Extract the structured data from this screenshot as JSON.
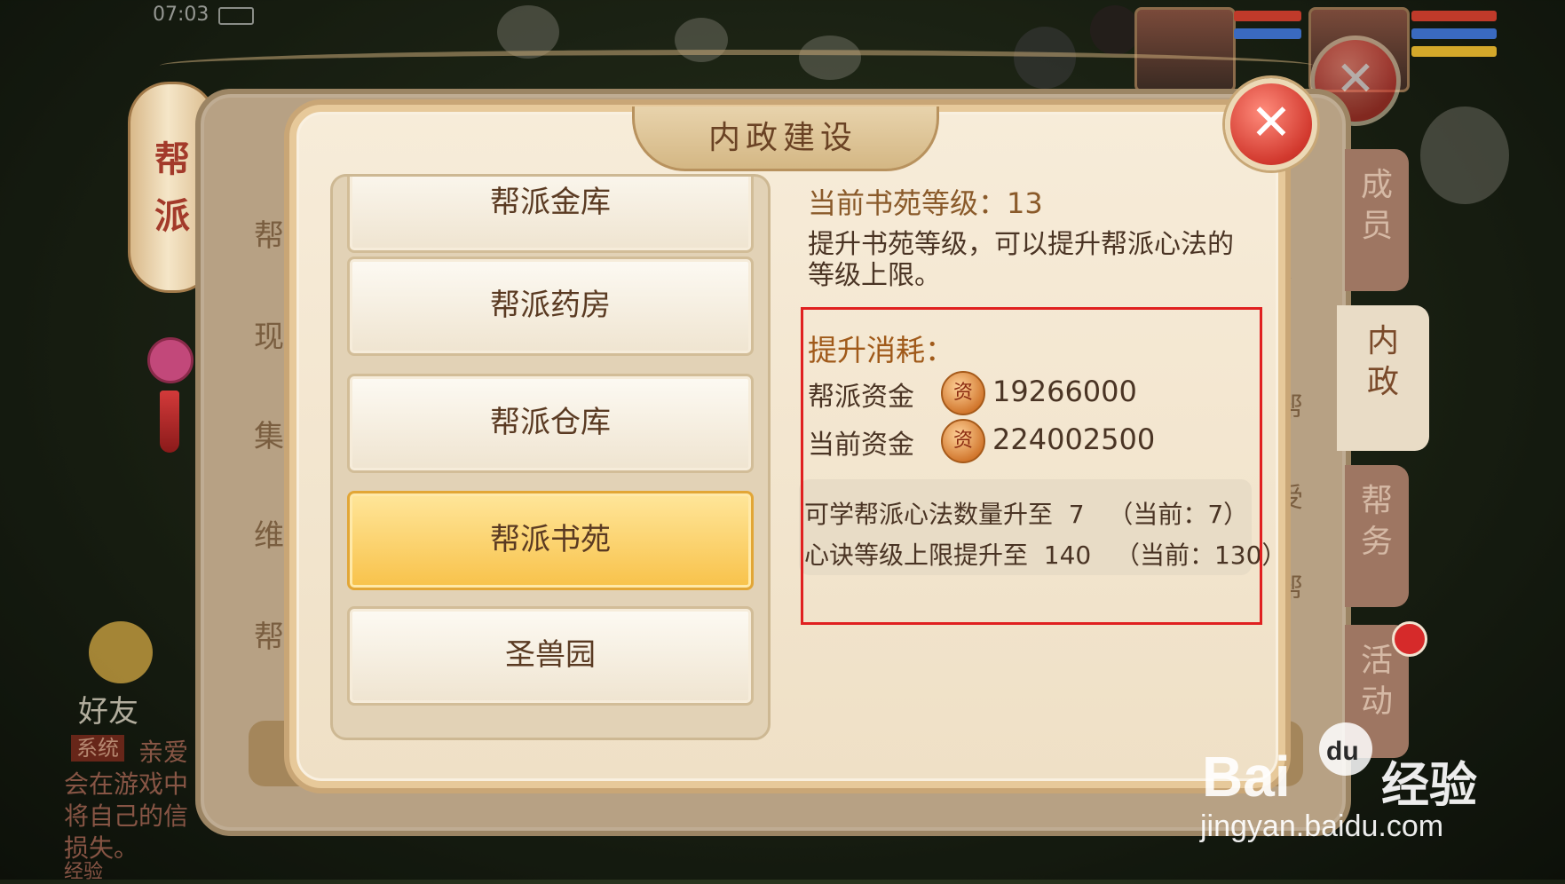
{
  "status": {
    "time": "07:03"
  },
  "lantern": {
    "top_char": "帮",
    "bottom_char": "派"
  },
  "outer": {
    "left_labels": [
      "帮",
      "现",
      "集",
      "维",
      "帮"
    ],
    "right_labels": [
      "受",
      "帮",
      "受",
      "帮"
    ],
    "side_tabs": [
      {
        "label": "成员",
        "active": false
      },
      {
        "label": "内政",
        "active": true
      },
      {
        "label": "帮务",
        "active": false
      },
      {
        "label": "活动",
        "active": false
      }
    ]
  },
  "chat": {
    "friend_label": "好友",
    "system_badge": "系统",
    "lines": [
      "亲爱",
      "会在游戏中",
      "将自己的信",
      "损失。",
      "经验"
    ]
  },
  "dialog": {
    "title": "内政建设",
    "close_glyph": "✕",
    "buildings": [
      {
        "label": "帮派金库",
        "selected": false
      },
      {
        "label": "帮派药房",
        "selected": false
      },
      {
        "label": "帮派仓库",
        "selected": false
      },
      {
        "label": "帮派书苑",
        "selected": true
      },
      {
        "label": "圣兽园",
        "selected": false
      }
    ],
    "detail": {
      "level_label": "当前书苑等级：13",
      "description": "提升书苑等级，可以提升帮派心法的等级上限。",
      "cost_title": "提升消耗：",
      "costs": [
        {
          "label": "帮派资金",
          "coin_char": "资",
          "value": "19266000"
        },
        {
          "label": "当前资金",
          "coin_char": "资",
          "value": "224002500"
        }
      ],
      "effects": [
        "可学帮派心法数量升至  7   （当前：7）",
        "心诀等级上限提升至  140   （当前：130）"
      ]
    }
  },
  "watermark": {
    "brand_a": "Bai",
    "brand_b": "du",
    "brand_c": "经验",
    "url": "jingyan.baidu.com"
  },
  "colors": {
    "selected_item": "#f8c24a",
    "highlight_box": "#e02020",
    "cost_title": "#a05a1a"
  }
}
